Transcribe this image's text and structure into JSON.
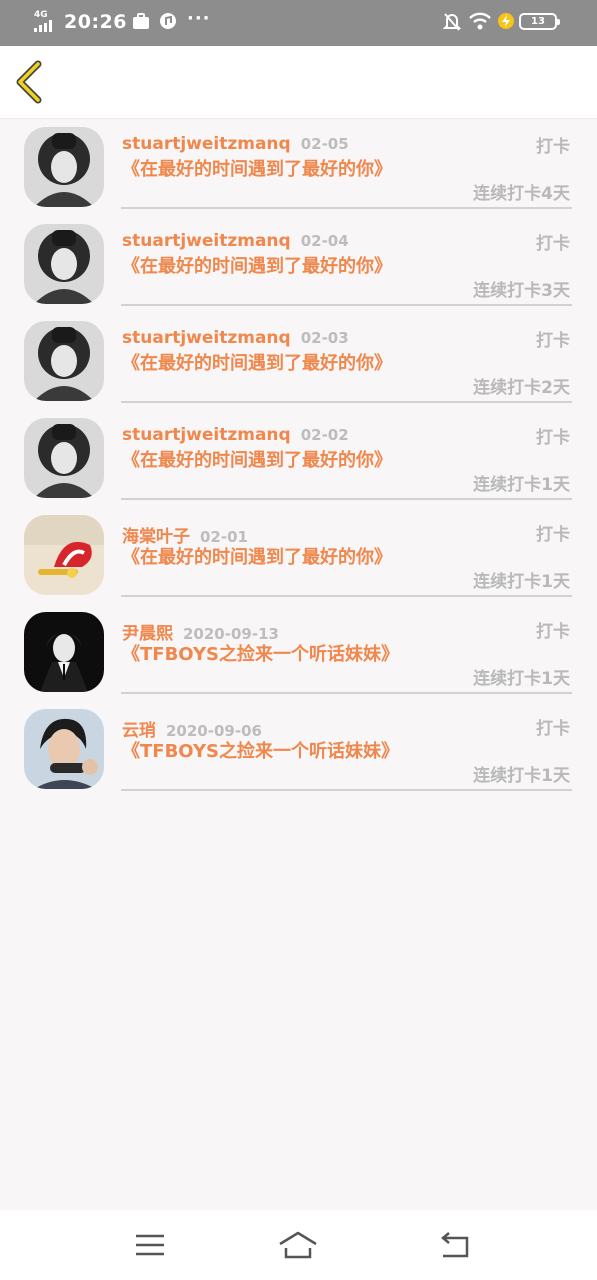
{
  "status_bar": {
    "network": "4G",
    "time": "20:26",
    "more": "···",
    "battery_level": "13"
  },
  "header": {
    "back_icon": "chevron-left-icon",
    "accent_color": "#f0874c"
  },
  "checkins": [
    {
      "user": "stuartjweitzmanq",
      "date": "02-05",
      "action": "打卡",
      "book": "《在最好的时间遇到了最好的你》",
      "streak": "连续打卡4天"
    },
    {
      "user": "stuartjweitzmanq",
      "date": "02-04",
      "action": "打卡",
      "book": "《在最好的时间遇到了最好的你》",
      "streak": "连续打卡3天"
    },
    {
      "user": "stuartjweitzmanq",
      "date": "02-03",
      "action": "打卡",
      "book": "《在最好的时间遇到了最好的你》",
      "streak": "连续打卡2天"
    },
    {
      "user": "stuartjweitzmanq",
      "date": "02-02",
      "action": "打卡",
      "book": "《在最好的时间遇到了最好的你》",
      "streak": "连续打卡1天"
    },
    {
      "user": "海棠叶子",
      "date": "02-01",
      "action": "打卡",
      "book": "《在最好的时间遇到了最好的你》",
      "streak": "连续打卡1天"
    },
    {
      "user": "尹晨熙",
      "date": "2020-09-13",
      "action": "打卡",
      "book": "《TFBOYS之捡来一个听话妹妹》",
      "streak": "连续打卡1天"
    },
    {
      "user": "云琑",
      "date": "2020-09-06",
      "action": "打卡",
      "book": "《TFBOYS之捡来一个听话妹妹》",
      "streak": "连续打卡1天"
    }
  ],
  "nav_bar": {
    "menu_icon": "menu-icon",
    "home_icon": "home-icon",
    "back_icon": "back-icon"
  }
}
